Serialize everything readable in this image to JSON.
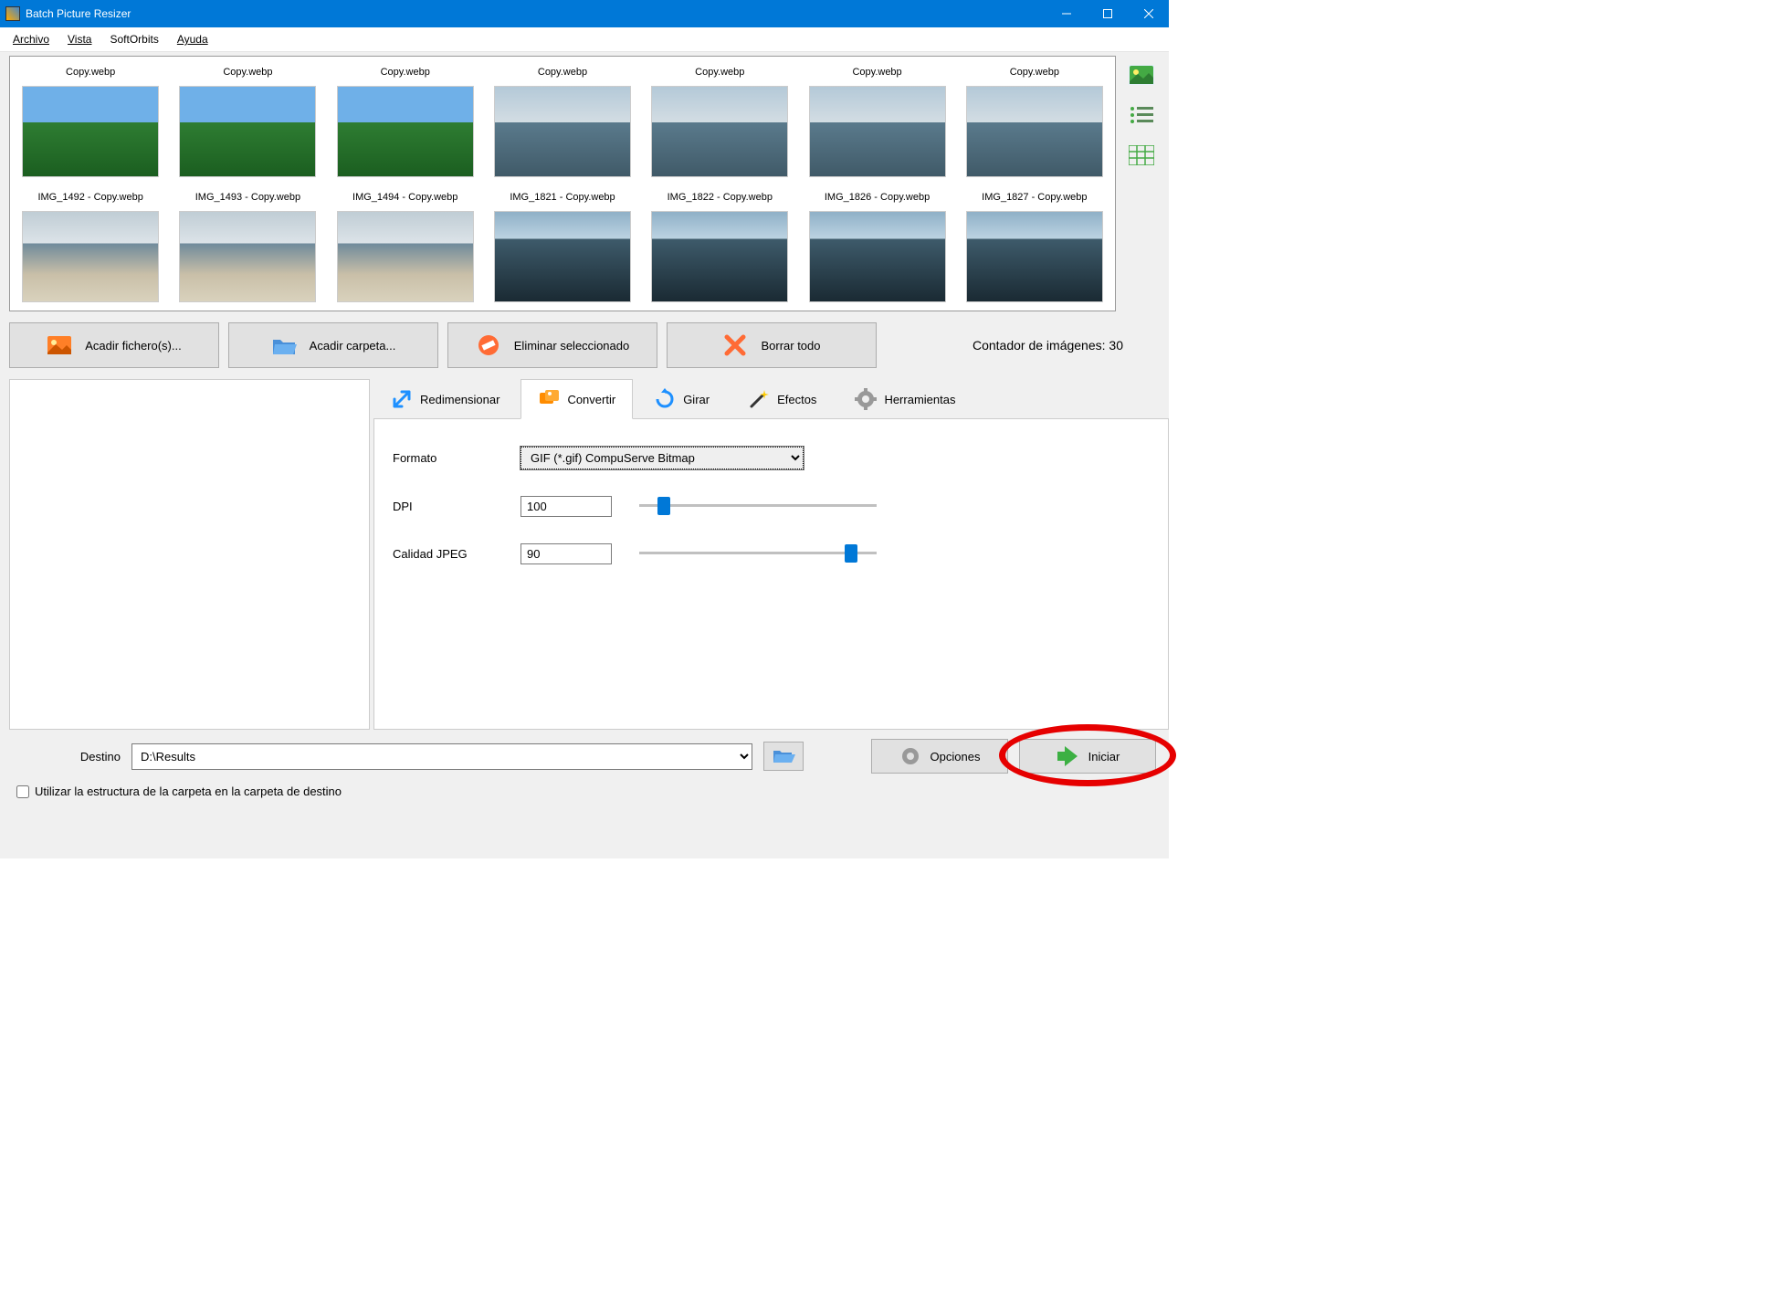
{
  "app": {
    "title": "Batch Picture Resizer"
  },
  "menu": {
    "archivo": "Archivo",
    "vista": "Vista",
    "softorbits": "SoftOrbits",
    "ayuda": "Ayuda"
  },
  "thumbnails": [
    {
      "label": "Copy.webp",
      "style": "mountain"
    },
    {
      "label": "Copy.webp",
      "style": "mountain"
    },
    {
      "label": "Copy.webp",
      "style": "mountain"
    },
    {
      "label": "Copy.webp",
      "style": "sea"
    },
    {
      "label": "Copy.webp",
      "style": "sea"
    },
    {
      "label": "Copy.webp",
      "style": "sea"
    },
    {
      "label": "Copy.webp",
      "style": "sea"
    },
    {
      "label": "IMG_1492 - Copy.webp",
      "style": "beach"
    },
    {
      "label": "IMG_1493 - Copy.webp",
      "style": "beach"
    },
    {
      "label": "IMG_1494 - Copy.webp",
      "style": "beach"
    },
    {
      "label": "IMG_1821 - Copy.webp",
      "style": "rocks"
    },
    {
      "label": "IMG_1822 - Copy.webp",
      "style": "rocks"
    },
    {
      "label": "IMG_1826 - Copy.webp",
      "style": "rocks"
    },
    {
      "label": "IMG_1827 - Copy.webp",
      "style": "rocks"
    }
  ],
  "actions": {
    "add_files": "Acadir fichero(s)...",
    "add_folder": "Acadir carpeta...",
    "remove_selected": "Eliminar seleccionado",
    "clear_all": "Borrar todo",
    "counter_label": "Contador de imágenes:",
    "counter_value": "30"
  },
  "tabs": {
    "resize": "Redimensionar",
    "convert": "Convertir",
    "rotate": "Girar",
    "effects": "Efectos",
    "tools": "Herramientas"
  },
  "convert_form": {
    "format_label": "Formato",
    "format_value": "GIF (*.gif) CompuServe Bitmap",
    "dpi_label": "DPI",
    "dpi_value": "100",
    "jpeg_quality_label": "Calidad JPEG",
    "jpeg_quality_value": "90"
  },
  "bottom": {
    "dest_label": "Destino",
    "dest_value": "D:\\Results",
    "options": "Opciones",
    "start": "Iniciar",
    "use_folder_structure": "Utilizar la estructura de la carpeta en la carpeta de destino"
  }
}
